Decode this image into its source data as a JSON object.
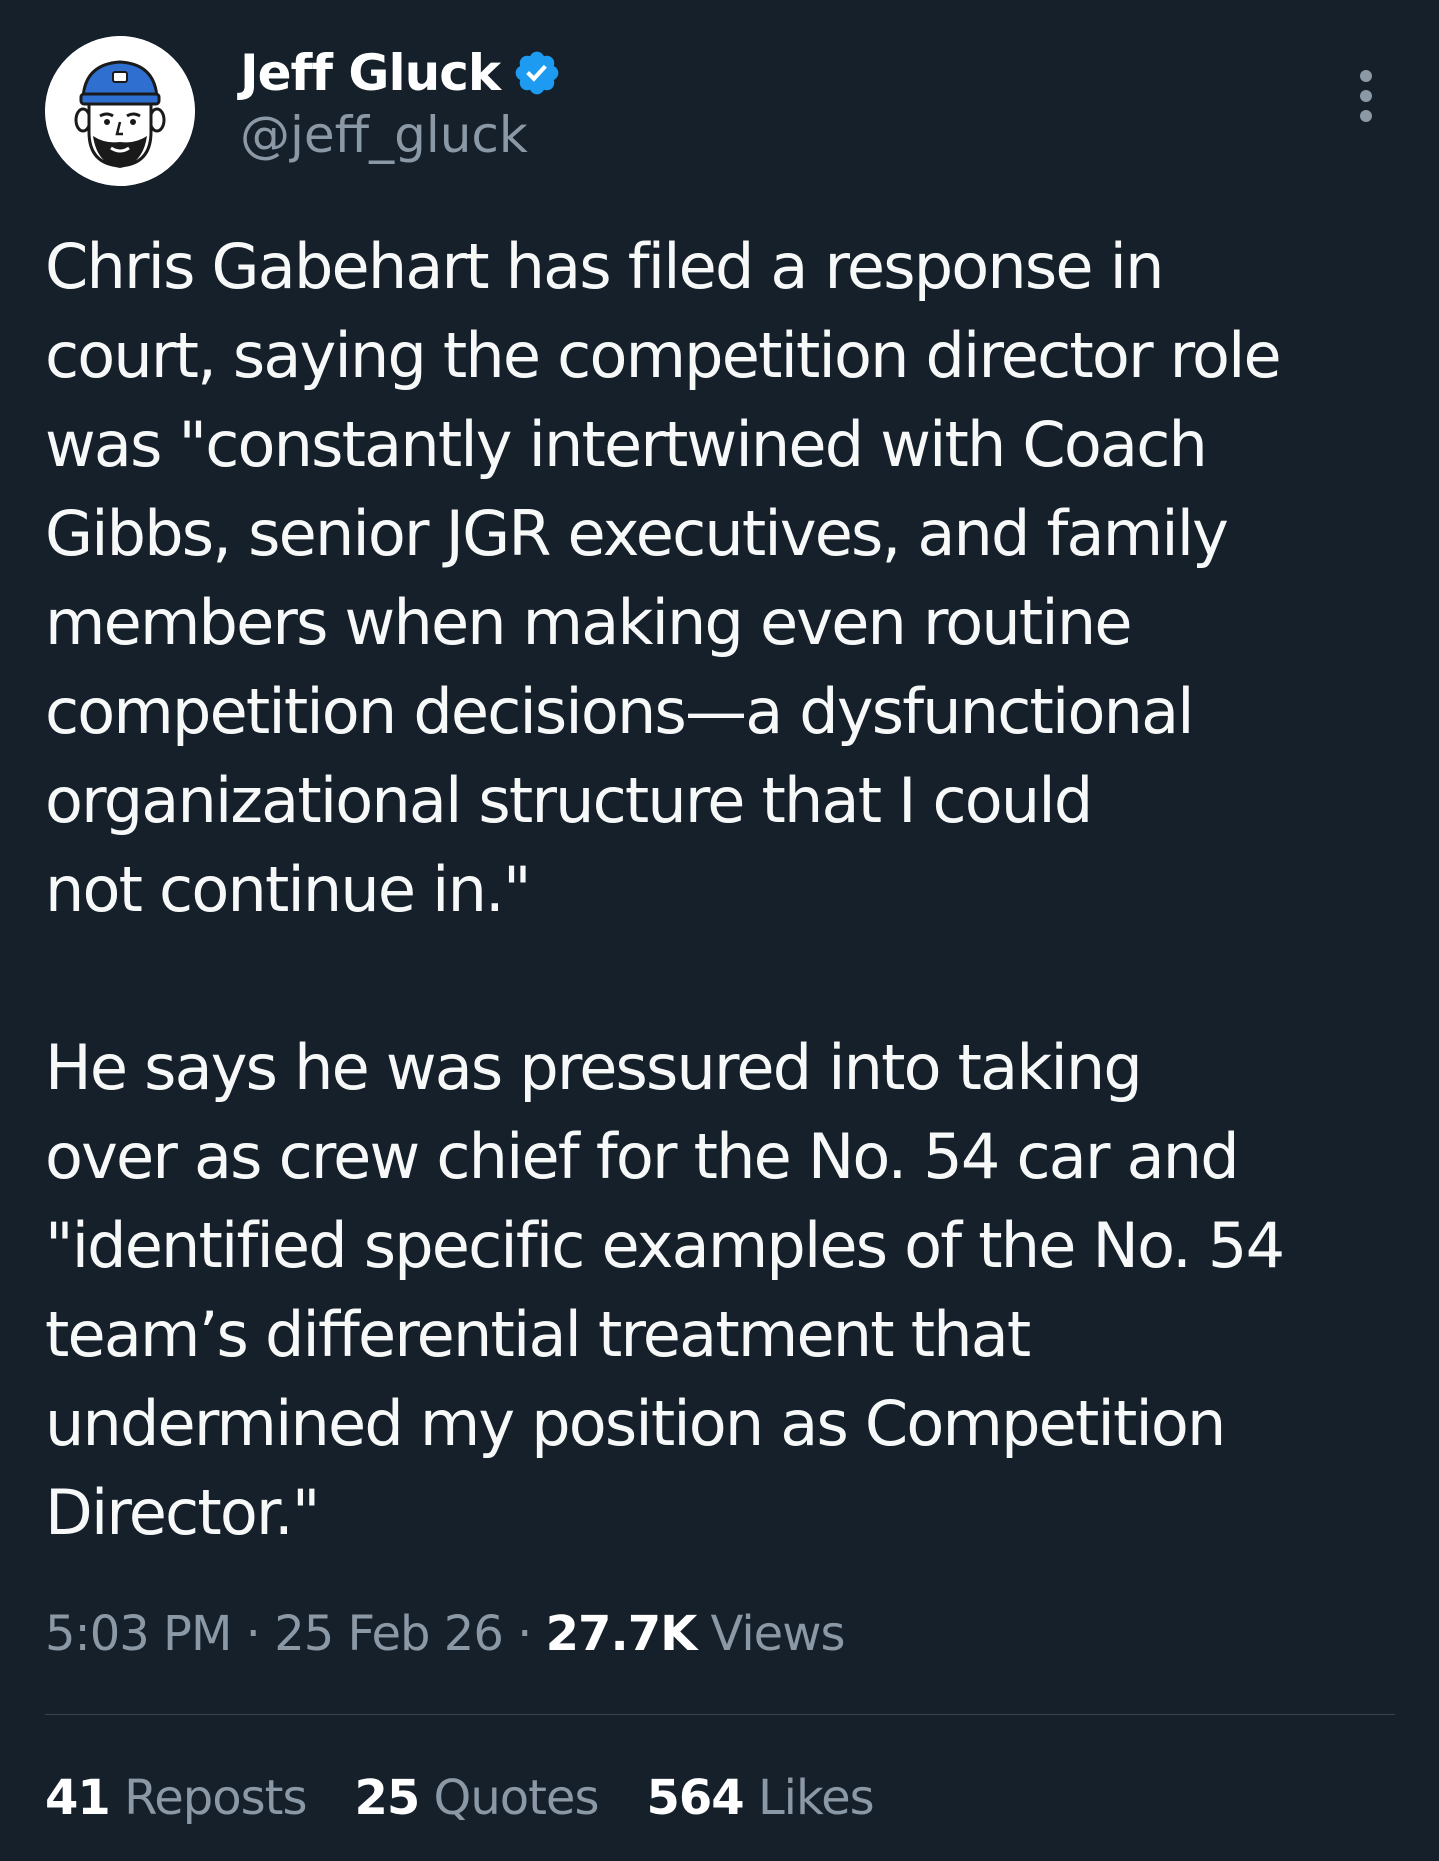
{
  "author": {
    "display_name": "Jeff Gluck",
    "handle": "@jeff_gluck",
    "avatar_icon": "cartoon-avatar-icon",
    "verified_icon": "verified-badge-icon",
    "verified_color": "#1d9bf0"
  },
  "more_icon": "more-vertical-icon",
  "tweet": {
    "paragraphs": [
      {
        "lines": [
          "Chris Gabehart has filed a response in",
          "court, saying the competition director role",
          "was \"constantly intertwined with Coach",
          "Gibbs, senior JGR executives, and family",
          "members when making even routine",
          "competition decisions—a dysfunctional",
          "organizational structure that I could",
          "not continue in.\""
        ]
      },
      {
        "lines": [
          "He says he was pressured into taking",
          "over as crew chief for the No. 54 car and",
          "\"identified specific examples of the No. 54",
          "team’s differential treatment that",
          "undermined my position as Competition",
          "Director.\""
        ]
      }
    ]
  },
  "meta": {
    "time": "5:03 PM",
    "separator": "·",
    "date": "25 Feb 26",
    "views_count": "27.7K",
    "views_label": "Views"
  },
  "stats": {
    "reposts_count": "41",
    "reposts_label": "Reposts",
    "quotes_count": "25",
    "quotes_label": "Quotes",
    "likes_count": "564",
    "likes_label": "Likes"
  },
  "colors": {
    "background": "#15202b",
    "text": "#f7f9f9",
    "secondary": "#8b98a5",
    "divider": "#38444d"
  }
}
